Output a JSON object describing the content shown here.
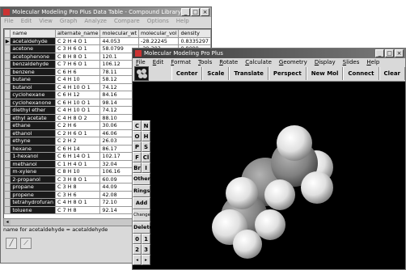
{
  "back_window": {
    "title": "Molecular Modeling Pro Plus Data Table - Compound Library",
    "menu": [
      "File",
      "Edit",
      "View",
      "Graph",
      "Analyze",
      "Compare",
      "Options",
      "Help"
    ],
    "columns": [
      "name",
      "alternate_name",
      "molecular_wt",
      "molecular_vol",
      "density"
    ],
    "rows": [
      [
        "acetaldehyde",
        "C 2 H 4 O 1",
        "44.053",
        "-28.22245",
        "0.8335297"
      ],
      [
        "acetone",
        "C 3 H 6 O 1",
        "58.0799",
        "-29.303",
        "0.8099"
      ],
      [
        "acetophenone",
        "C 8 H 8 O 1",
        "120.1",
        "",
        ""
      ],
      [
        "benzaldehyde",
        "C 7 H 6 O 1",
        "106.12",
        "",
        ""
      ],
      [
        "benzene",
        "C 6 H 6",
        "78.11",
        "",
        ""
      ],
      [
        "butane",
        "C 4 H 10",
        "58.12",
        "",
        ""
      ],
      [
        "butanol",
        "C 4 H 10 O 1",
        "74.12",
        "",
        ""
      ],
      [
        "cyclohexane",
        "C 6 H 12",
        "84.16",
        "",
        ""
      ],
      [
        "cyclohexanone",
        "C 6 H 10 O 1",
        "98.14",
        "",
        ""
      ],
      [
        "diethyl ether",
        "C 4 H 10 O 1",
        "74.12",
        "",
        ""
      ],
      [
        "ethyl acetate",
        "C 4 H 8 O 2",
        "88.10",
        "",
        ""
      ],
      [
        "ethane",
        "C 2 H 6",
        "30.06",
        "",
        ""
      ],
      [
        "ethanol",
        "C 2 H 6 O 1",
        "46.06",
        "",
        ""
      ],
      [
        "ethyne",
        "C 2 H 2",
        "26.03",
        "",
        ""
      ],
      [
        "hexane",
        "C 6 H 14",
        "86.17",
        "",
        ""
      ],
      [
        "1-hexanol",
        "C 6 H 14 O 1",
        "102.17",
        "",
        ""
      ],
      [
        "methanol",
        "C 1 H 4 O 1",
        "32.04",
        "",
        ""
      ],
      [
        "m-xylene",
        "C 8 H 10",
        "106.16",
        "",
        ""
      ],
      [
        "2-propanol",
        "C 3 H 8 O 1",
        "60.09",
        "",
        ""
      ],
      [
        "propane",
        "C 3 H 8",
        "44.09",
        "",
        ""
      ],
      [
        "propene",
        "C 3 H 6",
        "42.08",
        "",
        ""
      ],
      [
        "tetrahydrofuran",
        "C 4 H 8 O 1",
        "72.10",
        "",
        ""
      ],
      [
        "toluene",
        "C 7 H 8",
        "92.14",
        "",
        ""
      ]
    ],
    "status": "name for acetaldehyde = acetaldehyde"
  },
  "front_window": {
    "title": "Molecular Modeling Pro Plus",
    "menu": [
      "File",
      "Edit",
      "Format",
      "Tools",
      "Rotate",
      "Calculate",
      "Geometry",
      "Display",
      "Slides",
      "Help"
    ],
    "actions": [
      "Center",
      "Scale",
      "Translate",
      "Perspect",
      "New Mol",
      "Connect",
      "Clear"
    ],
    "palette": {
      "element_rows": [
        [
          "C",
          "N"
        ],
        [
          "O",
          "H"
        ],
        [
          "P",
          "S"
        ],
        [
          "F",
          "Cl"
        ],
        [
          "Br",
          "I"
        ]
      ],
      "other": "Other",
      "rings": "Rings",
      "add": "Add",
      "change": "Change",
      "delete": "Delete",
      "bond_rows": [
        [
          "0",
          "1"
        ],
        [
          "2",
          "3"
        ]
      ],
      "arrows": [
        "◂",
        "▸"
      ]
    }
  },
  "colors": {
    "carbon": "#7f7f7f",
    "hydrogen": "#e4e4e4",
    "background": "#000000"
  }
}
